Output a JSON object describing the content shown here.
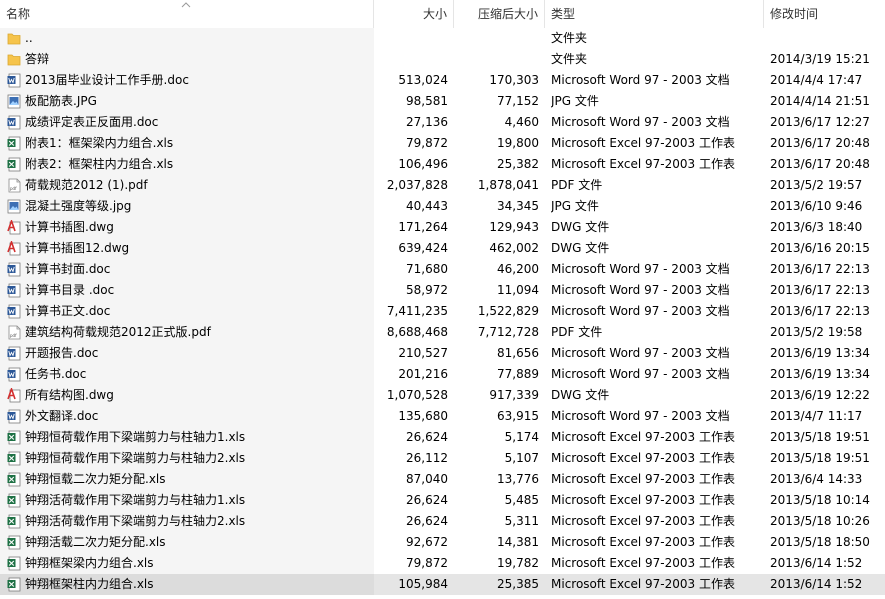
{
  "header": {
    "name_label": "名称",
    "size_label": "大小",
    "compressed_label": "压缩后大小",
    "type_label": "类型",
    "modified_label": "修改时间"
  },
  "colors": {
    "folder": "#f6c44b",
    "word": "#2b5797",
    "excel": "#1e7145",
    "dwg": "#d32f2f",
    "pdf": "#9e9e9e",
    "jpg": "#3c6fb4"
  },
  "rows": [
    {
      "name": "..",
      "size": "",
      "csize": "",
      "type": "文件夹",
      "mtime": "",
      "icon": "folder-icon"
    },
    {
      "name": "答辩",
      "size": "",
      "csize": "",
      "type": "文件夹",
      "mtime": "2014/3/19 15:21",
      "icon": "folder-icon"
    },
    {
      "name": "2013届毕业设计工作手册.doc",
      "size": "513,024",
      "csize": "170,303",
      "type": "Microsoft Word 97 - 2003 文档",
      "mtime": "2014/4/4 17:47",
      "icon": "word-doc-icon"
    },
    {
      "name": "板配筋表.JPG",
      "size": "98,581",
      "csize": "77,152",
      "type": "JPG 文件",
      "mtime": "2014/4/14 21:51",
      "icon": "jpg-icon"
    },
    {
      "name": "成绩评定表正反面用.doc",
      "size": "27,136",
      "csize": "4,460",
      "type": "Microsoft Word 97 - 2003 文档",
      "mtime": "2013/6/17 12:27",
      "icon": "word-doc-icon"
    },
    {
      "name": "附表1：框架梁内力组合.xls",
      "size": "79,872",
      "csize": "19,800",
      "type": "Microsoft Excel 97-2003 工作表",
      "mtime": "2013/6/17 20:48",
      "icon": "excel-xls-icon"
    },
    {
      "name": "附表2：框架柱内力组合.xls",
      "size": "106,496",
      "csize": "25,382",
      "type": "Microsoft Excel 97-2003 工作表",
      "mtime": "2013/6/17 20:48",
      "icon": "excel-xls-icon"
    },
    {
      "name": "荷载规范2012 (1).pdf",
      "size": "2,037,828",
      "csize": "1,878,041",
      "type": "PDF 文件",
      "mtime": "2013/5/2 19:57",
      "icon": "pdf-icon"
    },
    {
      "name": "混凝土强度等级.jpg",
      "size": "40,443",
      "csize": "34,345",
      "type": "JPG 文件",
      "mtime": "2013/6/10 9:46",
      "icon": "jpg-icon"
    },
    {
      "name": "计算书插图.dwg",
      "size": "171,264",
      "csize": "129,943",
      "type": "DWG 文件",
      "mtime": "2013/6/3 18:40",
      "icon": "dwg-icon"
    },
    {
      "name": "计算书插图12.dwg",
      "size": "639,424",
      "csize": "462,002",
      "type": "DWG 文件",
      "mtime": "2013/6/16 20:15",
      "icon": "dwg-icon"
    },
    {
      "name": "计算书封面.doc",
      "size": "71,680",
      "csize": "46,200",
      "type": "Microsoft Word 97 - 2003 文档",
      "mtime": "2013/6/17 22:13",
      "icon": "word-doc-icon"
    },
    {
      "name": "计算书目录 .doc",
      "size": "58,972",
      "csize": "11,094",
      "type": "Microsoft Word 97 - 2003 文档",
      "mtime": "2013/6/17 22:13",
      "icon": "word-doc-icon"
    },
    {
      "name": "计算书正文.doc",
      "size": "7,411,235",
      "csize": "1,522,829",
      "type": "Microsoft Word 97 - 2003 文档",
      "mtime": "2013/6/17 22:13",
      "icon": "word-doc-icon"
    },
    {
      "name": "建筑结构荷载规范2012正式版.pdf",
      "size": "8,688,468",
      "csize": "7,712,728",
      "type": "PDF 文件",
      "mtime": "2013/5/2 19:58",
      "icon": "pdf-icon"
    },
    {
      "name": "开题报告.doc",
      "size": "210,527",
      "csize": "81,656",
      "type": "Microsoft Word 97 - 2003 文档",
      "mtime": "2013/6/19 13:34",
      "icon": "word-doc-icon"
    },
    {
      "name": "任务书.doc",
      "size": "201,216",
      "csize": "77,889",
      "type": "Microsoft Word 97 - 2003 文档",
      "mtime": "2013/6/19 13:34",
      "icon": "word-doc-icon"
    },
    {
      "name": "所有结构图.dwg",
      "size": "1,070,528",
      "csize": "917,339",
      "type": "DWG 文件",
      "mtime": "2013/6/19 12:22",
      "icon": "dwg-icon"
    },
    {
      "name": "外文翻译.doc",
      "size": "135,680",
      "csize": "63,915",
      "type": "Microsoft Word 97 - 2003 文档",
      "mtime": "2013/4/7 11:17",
      "icon": "word-doc-icon"
    },
    {
      "name": "钟翔恒荷载作用下梁端剪力与柱轴力1.xls",
      "size": "26,624",
      "csize": "5,174",
      "type": "Microsoft Excel 97-2003 工作表",
      "mtime": "2013/5/18 19:51",
      "icon": "excel-xls-icon"
    },
    {
      "name": "钟翔恒荷载作用下梁端剪力与柱轴力2.xls",
      "size": "26,112",
      "csize": "5,107",
      "type": "Microsoft Excel 97-2003 工作表",
      "mtime": "2013/5/18 19:51",
      "icon": "excel-xls-icon"
    },
    {
      "name": "钟翔恒载二次力矩分配.xls",
      "size": "87,040",
      "csize": "13,776",
      "type": "Microsoft Excel 97-2003 工作表",
      "mtime": "2013/6/4 14:33",
      "icon": "excel-xls-icon"
    },
    {
      "name": "钟翔活荷载作用下梁端剪力与柱轴力1.xls",
      "size": "26,624",
      "csize": "5,485",
      "type": "Microsoft Excel 97-2003 工作表",
      "mtime": "2013/5/18 10:14",
      "icon": "excel-xls-icon"
    },
    {
      "name": "钟翔活荷载作用下梁端剪力与柱轴力2.xls",
      "size": "26,624",
      "csize": "5,311",
      "type": "Microsoft Excel 97-2003 工作表",
      "mtime": "2013/5/18 10:26",
      "icon": "excel-xls-icon"
    },
    {
      "name": "钟翔活载二次力矩分配.xls",
      "size": "92,672",
      "csize": "14,381",
      "type": "Microsoft Excel 97-2003 工作表",
      "mtime": "2013/5/18 18:50",
      "icon": "excel-xls-icon"
    },
    {
      "name": "钟翔框架梁内力组合.xls",
      "size": "79,872",
      "csize": "19,782",
      "type": "Microsoft Excel 97-2003 工作表",
      "mtime": "2013/6/14 1:52",
      "icon": "excel-xls-icon"
    },
    {
      "name": "钟翔框架柱内力组合.xls",
      "size": "105,984",
      "csize": "25,385",
      "type": "Microsoft Excel 97-2003 工作表",
      "mtime": "2013/6/14 1:52",
      "icon": "excel-xls-icon",
      "selected": true
    }
  ]
}
